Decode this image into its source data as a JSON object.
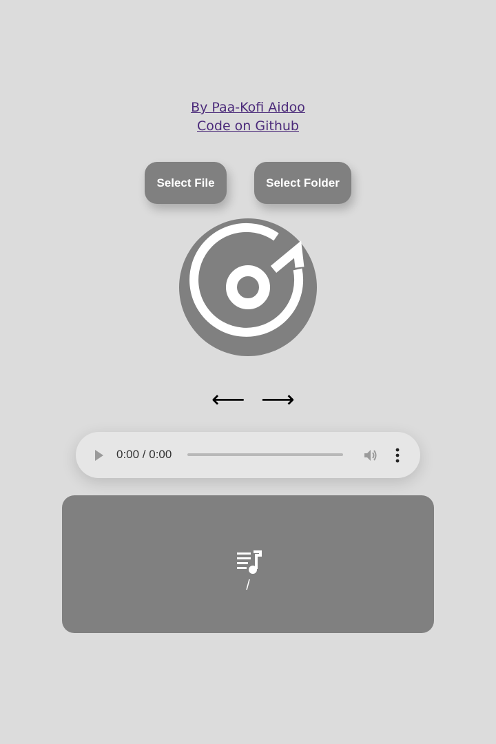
{
  "credits": {
    "author_link": "By Paa-Kofi Aidoo",
    "code_link": "Code on Github"
  },
  "buttons": {
    "select_file": "Select File",
    "select_folder": "Select Folder"
  },
  "navigation": {
    "prev": "⟵",
    "next": "⟶"
  },
  "audio_player": {
    "time_display": "0:00 / 0:00",
    "progress": 0,
    "icons": [
      "play-icon",
      "volume-icon",
      "more-options-icon"
    ]
  },
  "playlist": {
    "icon": "playlist-music-icon",
    "path": "/"
  },
  "colors": {
    "background": "#dcdcdc",
    "accent_gray": "#808080",
    "link": "#4b2a7a",
    "white": "#ffffff"
  }
}
